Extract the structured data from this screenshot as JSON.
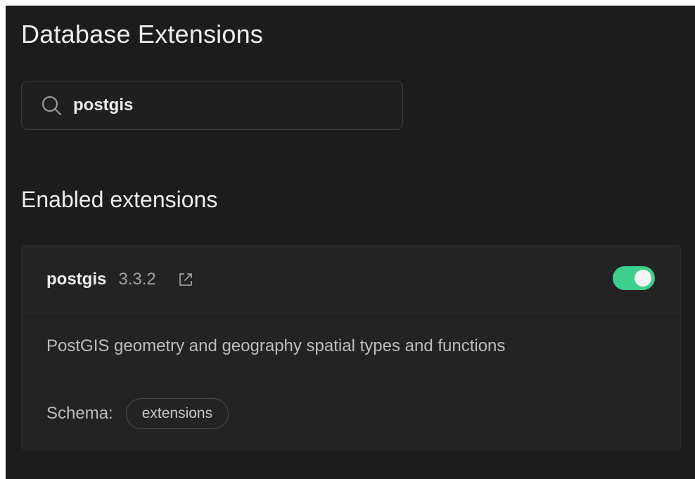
{
  "header": {
    "title": "Database Extensions"
  },
  "search": {
    "value": "postgis",
    "icon": "search-icon"
  },
  "enabled_section": {
    "title": "Enabled extensions",
    "extensions": [
      {
        "name": "postgis",
        "version": "3.3.2",
        "link_icon": "external-link-icon",
        "enabled": true,
        "description": "PostGIS geometry and geography spatial types and functions",
        "schema_label": "Schema:",
        "schema": "extensions"
      }
    ]
  },
  "colors": {
    "background": "#1c1c1c",
    "card": "#232323",
    "accent": "#3ecf8e",
    "text": "#ededed",
    "muted": "#a0a0a0"
  }
}
